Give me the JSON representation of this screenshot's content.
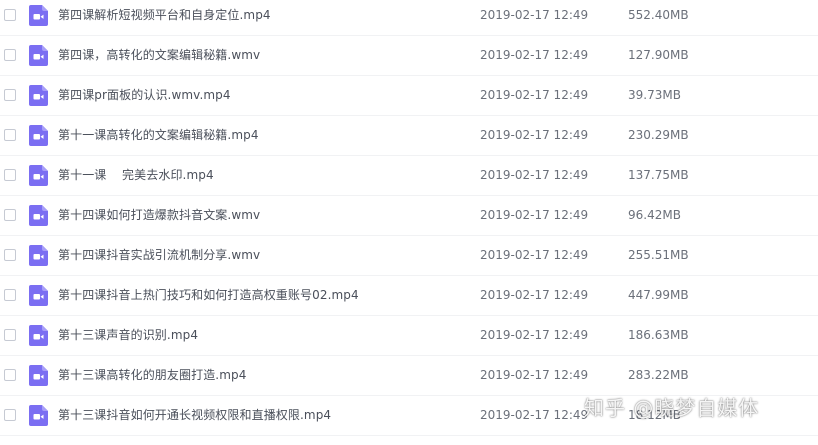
{
  "files": [
    {
      "name": "第四课解析短视频平台和自身定位.mp4",
      "date": "2019-02-17 12:49",
      "size": "552.40MB",
      "icon": "video-file-icon"
    },
    {
      "name": "第四课，高转化的文案编辑秘籍.wmv",
      "date": "2019-02-17 12:49",
      "size": "127.90MB",
      "icon": "video-file-icon"
    },
    {
      "name": "第四课pr面板的认识.wmv.mp4",
      "date": "2019-02-17 12:49",
      "size": "39.73MB",
      "icon": "video-file-icon"
    },
    {
      "name": "第十一课高转化的文案编辑秘籍.mp4",
      "date": "2019-02-17 12:49",
      "size": "230.29MB",
      "icon": "video-file-icon"
    },
    {
      "name": "第十一课    完美去水印.mp4",
      "date": "2019-02-17 12:49",
      "size": "137.75MB",
      "icon": "video-file-icon"
    },
    {
      "name": "第十四课如何打造爆款抖音文案.wmv",
      "date": "2019-02-17 12:49",
      "size": "96.42MB",
      "icon": "video-file-icon"
    },
    {
      "name": "第十四课抖音实战引流机制分享.wmv",
      "date": "2019-02-17 12:49",
      "size": "255.51MB",
      "icon": "video-file-icon"
    },
    {
      "name": "第十四课抖音上热门技巧和如何打造高权重账号02.mp4",
      "date": "2019-02-17 12:49",
      "size": "447.99MB",
      "icon": "video-file-icon"
    },
    {
      "name": "第十三课声音的识别.mp4",
      "date": "2019-02-17 12:49",
      "size": "186.63MB",
      "icon": "video-file-icon"
    },
    {
      "name": "第十三课高转化的朋友圈打造.mp4",
      "date": "2019-02-17 12:49",
      "size": "283.22MB",
      "icon": "video-file-icon"
    },
    {
      "name": "第十三课抖音如何开通长视频权限和直播权限.mp4",
      "date": "2019-02-17 12:49",
      "size": "18.12MB",
      "icon": "video-file-icon"
    }
  ],
  "watermark": "知乎 @晓梦自媒体",
  "colors": {
    "icon_purple": "#7b6ef2",
    "icon_light": "#a79ef8",
    "text": "#4a4f5a",
    "meta_text": "#6b707a",
    "checkbox_border": "#c6cad3"
  }
}
